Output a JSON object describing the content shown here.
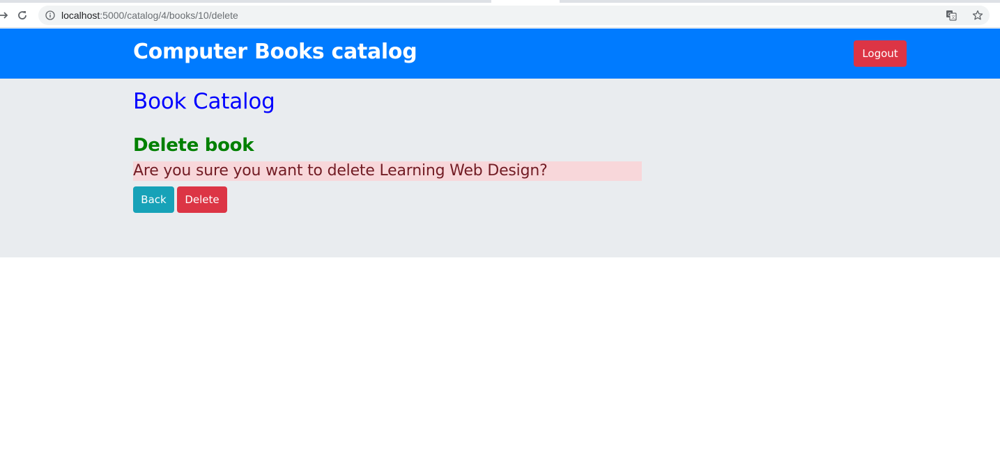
{
  "browser": {
    "url_host": "localhost",
    "url_path": ":5000/catalog/4/books/10/delete",
    "icons": {
      "forward": "forward-arrow-icon",
      "reload": "reload-icon",
      "info": "info-icon",
      "translate": "translate-icon",
      "bookmark": "star-icon"
    }
  },
  "navbar": {
    "brand": "Computer Books catalog",
    "logout_label": "Logout",
    "background_color": "#007bff",
    "logout_color": "#dc3545"
  },
  "main": {
    "page_title": "Book Catalog",
    "section_title": "Delete book",
    "confirm_message": "Are you sure you want to delete Learning Web Design?",
    "back_label": "Back",
    "delete_label": "Delete",
    "colors": {
      "page_title": "#0000ff",
      "section_title": "#008000",
      "alert_background": "#f8d7da",
      "alert_text": "#721c24",
      "back_button": "#17a2b8",
      "delete_button": "#dc3545",
      "jumbotron_background": "#e9ecef"
    }
  }
}
